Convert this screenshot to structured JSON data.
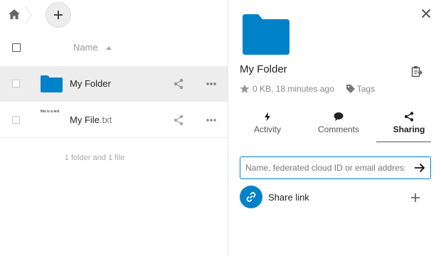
{
  "files": {
    "column_name": "Name",
    "rows": [
      {
        "name": "My Folder",
        "ext": "",
        "type": "folder",
        "selected": true
      },
      {
        "name": "My File",
        "ext": ".txt",
        "type": "file",
        "thumb_text": "this is a text",
        "selected": false
      }
    ],
    "summary": "1 folder and 1 file"
  },
  "sidebar": {
    "title": "My Folder",
    "meta": "0 KB, 18 minutes ago",
    "tags_label": "Tags",
    "tabs": [
      {
        "label": "Activity",
        "icon": "lightning-icon",
        "active": false
      },
      {
        "label": "Comments",
        "icon": "comment-icon",
        "active": false
      },
      {
        "label": "Sharing",
        "icon": "share-icon",
        "active": true
      }
    ],
    "share_placeholder": "Name, federated cloud ID or email address …",
    "share_link_label": "Share link"
  },
  "colors": {
    "accent": "#0082c9",
    "selected_row": "#ededed",
    "muted_text": "#888888"
  }
}
